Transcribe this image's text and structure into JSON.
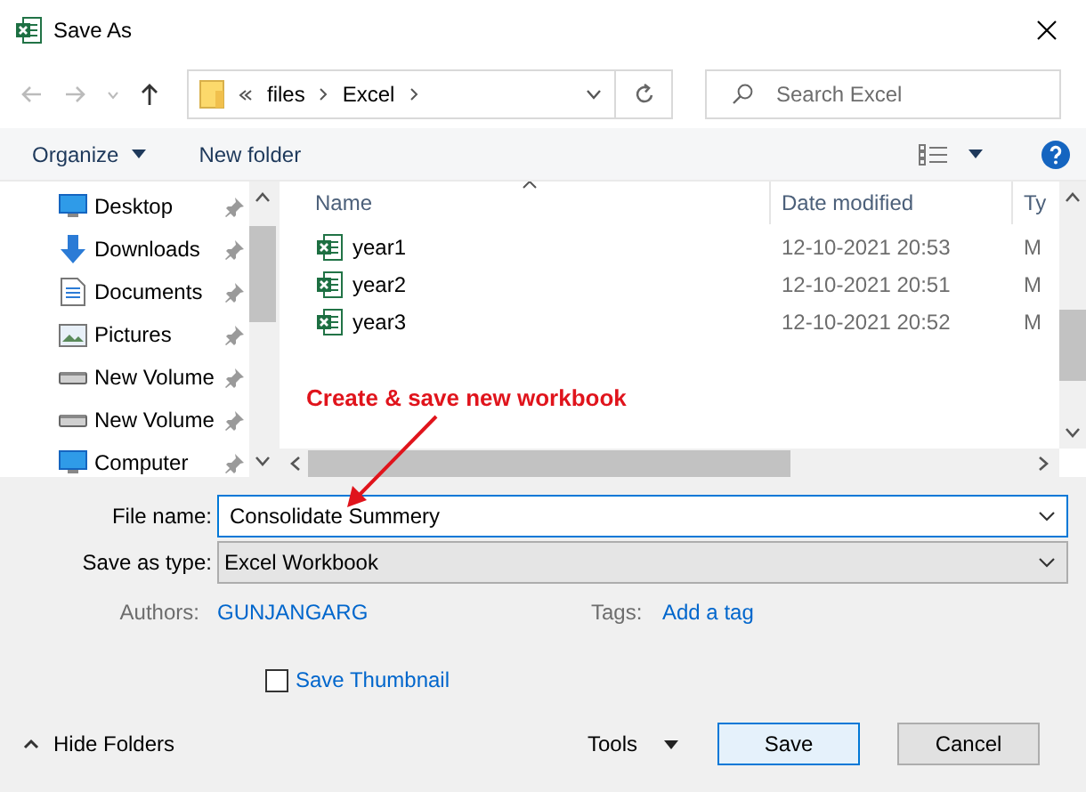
{
  "window": {
    "title": "Save As"
  },
  "address": {
    "crumbs": [
      "files",
      "Excel"
    ]
  },
  "search": {
    "placeholder": "Search Excel"
  },
  "toolbar": {
    "organize": "Organize",
    "new_folder": "New folder"
  },
  "sidebar": {
    "items": [
      {
        "label": "Desktop",
        "kind": "desktop"
      },
      {
        "label": "Downloads",
        "kind": "downloads"
      },
      {
        "label": "Documents",
        "kind": "documents"
      },
      {
        "label": "Pictures",
        "kind": "pictures"
      },
      {
        "label": "New Volume",
        "kind": "drive"
      },
      {
        "label": "New Volume",
        "kind": "drive"
      },
      {
        "label": "Computer",
        "kind": "desktop"
      }
    ]
  },
  "files": {
    "columns": [
      "Name",
      "Date modified",
      "Ty"
    ],
    "rows": [
      {
        "name": "year1",
        "date": "12-10-2021 20:53",
        "type": "M"
      },
      {
        "name": "year2",
        "date": "12-10-2021 20:51",
        "type": "M"
      },
      {
        "name": "year3",
        "date": "12-10-2021 20:52",
        "type": "M"
      }
    ]
  },
  "annotation": {
    "text": "Create & save new workbook"
  },
  "form": {
    "file_name": {
      "label": "File name:",
      "value": "Consolidate Summery"
    },
    "save_as_type": {
      "label": "Save as type:",
      "value": "Excel Workbook"
    },
    "authors": {
      "label": "Authors:",
      "value": "GUNJANGARG"
    },
    "tags": {
      "label": "Tags:",
      "link": "Add a tag"
    },
    "thumbnail": {
      "label": "Save Thumbnail",
      "checked": false
    }
  },
  "footer": {
    "hide_folders": "Hide Folders",
    "tools": "Tools",
    "buttons": [
      {
        "label": "Save",
        "default": true
      },
      {
        "label": "Cancel",
        "default": false
      }
    ]
  }
}
